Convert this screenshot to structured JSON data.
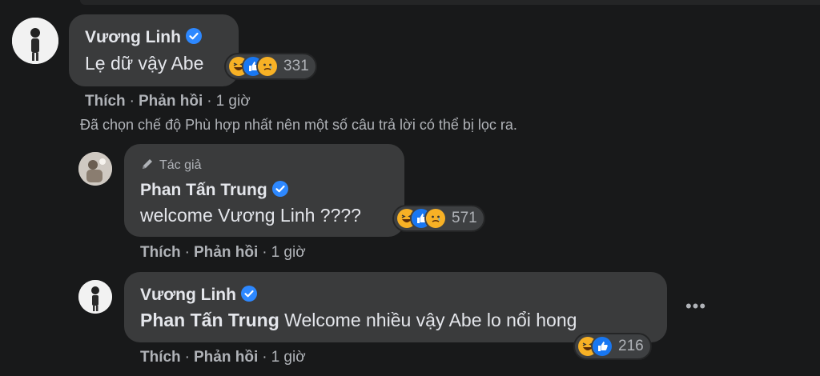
{
  "comments": [
    {
      "author": "Vương Linh",
      "text": "Lẹ dữ vậy Abe",
      "reaction_count": "331",
      "reactions": [
        "haha-icon",
        "like-icon",
        "care-icon"
      ],
      "actions": {
        "like": "Thích",
        "reply": "Phản hồi",
        "time": "1 giờ"
      }
    },
    {
      "author_badge": "Tác giả",
      "author": "Phan Tấn Trung",
      "text": "welcome Vương Linh ????",
      "reaction_count": "571",
      "reactions": [
        "haha-icon",
        "like-icon",
        "care-icon"
      ],
      "actions": {
        "like": "Thích",
        "reply": "Phản hồi",
        "time": "1 giờ"
      }
    },
    {
      "author": "Vương Linh",
      "mention": "Phan Tấn Trung",
      "text": "Welcome nhiều vậy Abe lo nổi hong",
      "reaction_count": "216",
      "reactions": [
        "haha-icon",
        "like-icon"
      ],
      "actions": {
        "like": "Thích",
        "reply": "Phản hồi",
        "time": "1 giờ"
      }
    }
  ],
  "filter_notice": "Đã chọn chế độ Phù hợp nhất nên một số câu trả lời có thể bị lọc ra.",
  "more_options": "•••",
  "colors": {
    "background": "#18191a",
    "bubble": "#3a3b3c",
    "text": "#e4e6eb",
    "secondary": "#b0b3b8",
    "verified": "#2d88ff"
  }
}
